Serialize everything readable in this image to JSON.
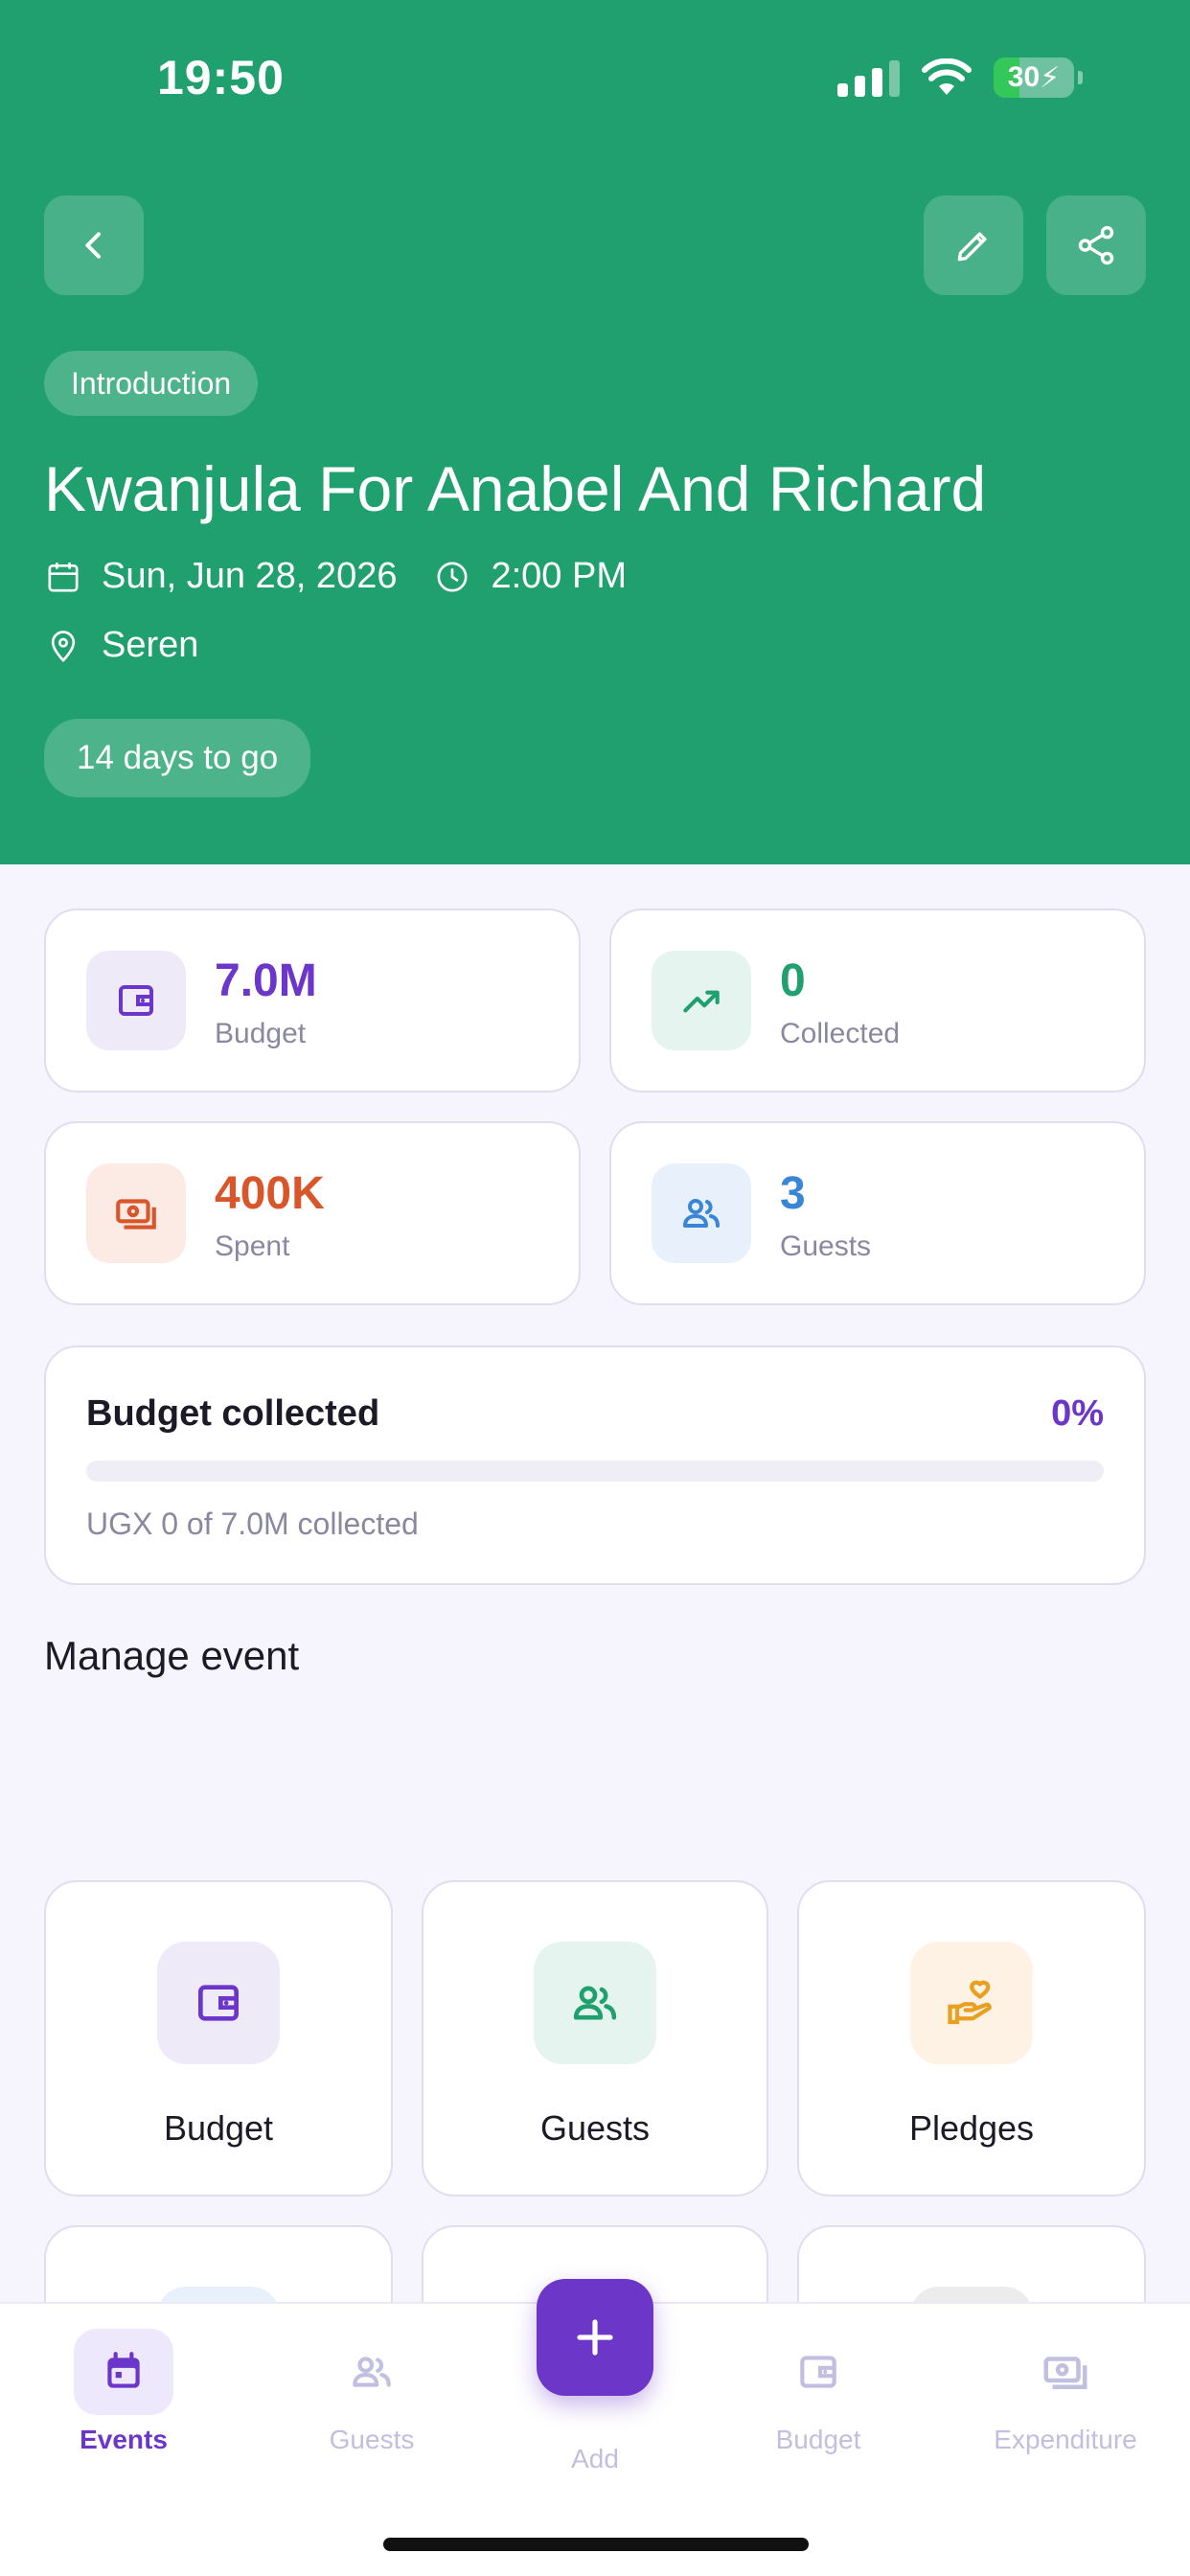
{
  "status_bar": {
    "time": "19:50",
    "battery": "30"
  },
  "header": {
    "category": "Introduction",
    "title": "Kwanjula For Anabel And Richard",
    "date": "Sun, Jun 28, 2026",
    "time": "2:00 PM",
    "location": "Seren",
    "countdown": "14 days to go",
    "color": "#21a06f"
  },
  "stats": {
    "budget": {
      "value": "7.0M",
      "label": "Budget",
      "color": "#6b36c9"
    },
    "collected": {
      "value": "0",
      "label": "Collected",
      "color": "#21a06f"
    },
    "spent": {
      "value": "400K",
      "label": "Spent",
      "color": "#d8562a"
    },
    "guests": {
      "value": "3",
      "label": "Guests",
      "color": "#3a86d6"
    }
  },
  "progress": {
    "title": "Budget collected",
    "percent_label": "0%",
    "fraction": 0,
    "caption": "UGX 0 of 7.0M collected"
  },
  "manage": {
    "title": "Manage event",
    "tiles": [
      {
        "label": "Budget",
        "icon": "wallet-icon"
      },
      {
        "label": "Guests",
        "icon": "people-icon"
      },
      {
        "label": "Pledges",
        "icon": "hand-heart-icon"
      }
    ]
  },
  "tabbar": {
    "events": "Events",
    "guests": "Guests",
    "add": "Add",
    "budget": "Budget",
    "expenditure": "Expenditure"
  }
}
